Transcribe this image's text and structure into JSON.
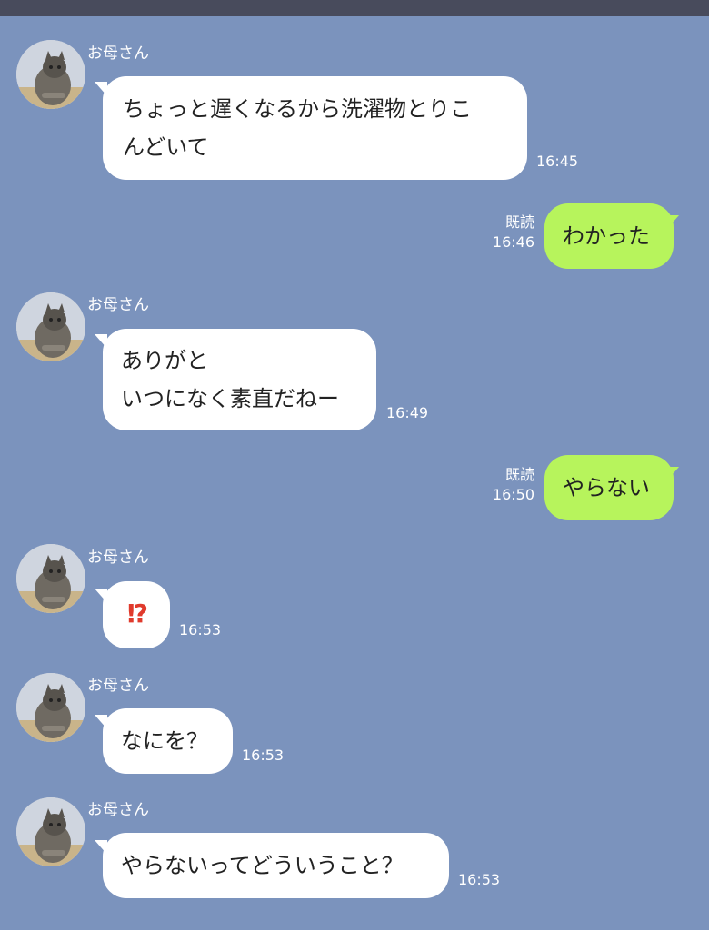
{
  "chat": {
    "contact_name": "お母さん",
    "colors": {
      "background": "#7b93bd",
      "incoming_bubble": "#ffffff",
      "outgoing_bubble": "#b7f45c",
      "top_bar": "#484b5c"
    },
    "messages": [
      {
        "direction": "in",
        "sender": "お母さん",
        "lines": [
          "ちょっと遅くなるから洗濯物とりこ",
          "んどいて"
        ],
        "time": "16:45"
      },
      {
        "direction": "out",
        "read_label": "既読",
        "lines": [
          "わかった"
        ],
        "time": "16:46"
      },
      {
        "direction": "in",
        "sender": "お母さん",
        "lines": [
          "ありがと",
          "いつになく素直だねー"
        ],
        "time": "16:49"
      },
      {
        "direction": "out",
        "read_label": "既読",
        "lines": [
          "やらない"
        ],
        "time": "16:50"
      },
      {
        "direction": "in",
        "sender": "お母さん",
        "lines": [
          "⁉"
        ],
        "emoji": "exclamation-question-mark",
        "time": "16:53"
      },
      {
        "direction": "in",
        "sender": "お母さん",
        "lines": [
          "なにを？"
        ],
        "time": "16:53"
      },
      {
        "direction": "in",
        "sender": "お母さん",
        "lines": [
          "やらないってどういうこと？"
        ],
        "time": "16:53"
      }
    ]
  },
  "icons": {
    "avatar": "cat-avatar-icon"
  }
}
